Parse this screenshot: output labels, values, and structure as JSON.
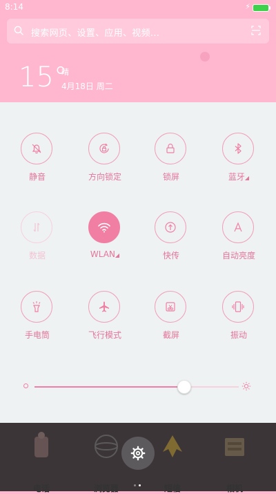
{
  "status_bar": {
    "time": "8:14",
    "charging_symbol": "⚡"
  },
  "search": {
    "placeholder": "搜索网页、设置、应用、视频..."
  },
  "weather": {
    "temperature": "15°",
    "condition": "晴",
    "date": "4月18日 周二"
  },
  "toggles": [
    {
      "label": "静音",
      "icon": "bell-off-icon",
      "state": "off"
    },
    {
      "label": "方向锁定",
      "icon": "rotation-lock-icon",
      "state": "off"
    },
    {
      "label": "锁屏",
      "icon": "lock-icon",
      "state": "off"
    },
    {
      "label": "蓝牙",
      "icon": "bluetooth-icon",
      "state": "off",
      "has_submenu": true
    },
    {
      "label": "数据",
      "icon": "mobile-data-icon",
      "state": "disabled"
    },
    {
      "label": "WLAN",
      "icon": "wifi-icon",
      "state": "on",
      "has_submenu": true
    },
    {
      "label": "快传",
      "icon": "quick-transfer-icon",
      "state": "off"
    },
    {
      "label": "自动亮度",
      "icon": "auto-brightness-icon",
      "state": "off"
    },
    {
      "label": "手电筒",
      "icon": "flashlight-icon",
      "state": "off"
    },
    {
      "label": "飞行模式",
      "icon": "airplane-icon",
      "state": "off"
    },
    {
      "label": "截屏",
      "icon": "screenshot-icon",
      "state": "off"
    },
    {
      "label": "振动",
      "icon": "vibrate-icon",
      "state": "off"
    }
  ],
  "brightness": {
    "level": 0.73
  },
  "dock": {
    "apps": [
      {
        "label": "电话",
        "icon": "phone-icon"
      },
      {
        "label": "浏览器",
        "icon": "browser-icon"
      },
      {
        "label": "短信",
        "icon": "messages-icon"
      },
      {
        "label": "相机",
        "icon": "camera-icon"
      }
    ],
    "page_indicator": {
      "pages": 2,
      "current": 2
    }
  },
  "colors": {
    "accent": "#f07fa3",
    "header_bg": "#ffb6cf",
    "panel_bg": "#eef2f3"
  }
}
